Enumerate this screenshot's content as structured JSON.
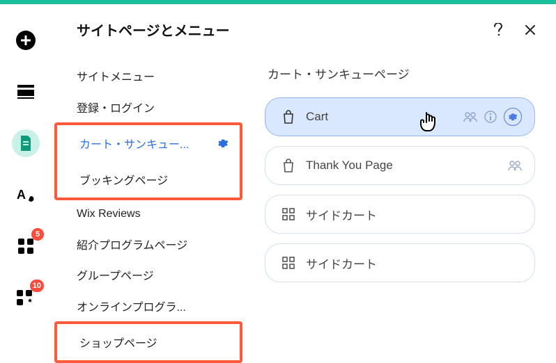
{
  "header": {
    "title": "サイトページとメニュー"
  },
  "left_rail": {
    "badges": {
      "apps": "5",
      "settings": "10"
    }
  },
  "sidebar": {
    "items": [
      {
        "label": "サイトメニュー",
        "highlight": false
      },
      {
        "label": "登録・ログイン",
        "highlight": false
      },
      {
        "label": "カート・サンキュー...",
        "highlight": true,
        "selected": true
      },
      {
        "label": "ブッキングページ",
        "highlight": true
      },
      {
        "label": "Wix Reviews",
        "highlight": false
      },
      {
        "label": "紹介プログラムページ",
        "highlight": false
      },
      {
        "label": "グループページ",
        "highlight": false
      },
      {
        "label": "オンラインプログラ...",
        "highlight": false
      },
      {
        "label": "ショップページ",
        "highlight": true
      }
    ]
  },
  "right": {
    "title": "カート・サンキューページ",
    "pages": [
      {
        "label": "Cart",
        "icon": "bag",
        "active": true,
        "actions": [
          "members",
          "info",
          "gear"
        ]
      },
      {
        "label": "Thank You Page",
        "icon": "bag",
        "active": false,
        "actions": [
          "members"
        ]
      },
      {
        "label": "サイドカート",
        "icon": "grid",
        "active": false,
        "actions": []
      },
      {
        "label": "サイドカート",
        "icon": "grid",
        "active": false,
        "actions": []
      }
    ]
  }
}
